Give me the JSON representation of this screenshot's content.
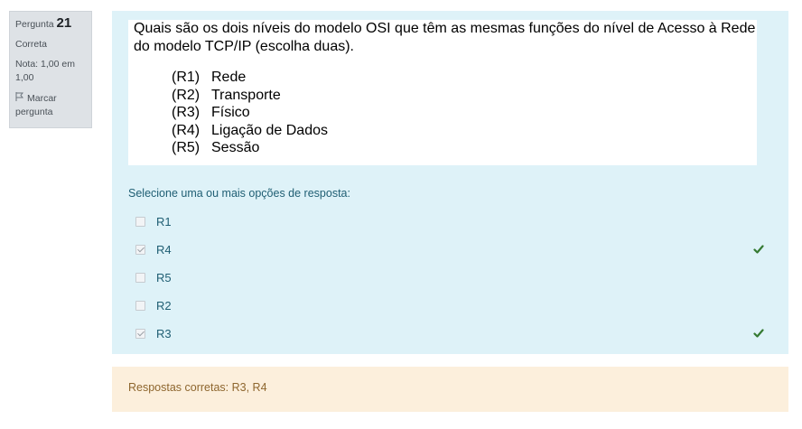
{
  "info": {
    "question_label": "Pergunta",
    "question_number": "21",
    "state": "Correta",
    "grade": "Nota: 1,00 em 1,00",
    "flag_label": "Marcar pergunta"
  },
  "question": {
    "stem": "Quais são os dois níveis do modelo OSI que têm as mesmas funções do nível de Acesso à Rede do modelo TCP/IP (escolha duas).",
    "options": [
      {
        "code": "(R1)",
        "text": "Rede"
      },
      {
        "code": "(R2)",
        "text": "Transporte"
      },
      {
        "code": "(R3)",
        "text": "Físico"
      },
      {
        "code": "(R4)",
        "text": "Ligação de Dados"
      },
      {
        "code": "(R5)",
        "text": "Sessão"
      }
    ]
  },
  "prompt": "Selecione uma ou mais opções de resposta:",
  "answers": [
    {
      "label": "R1",
      "checked": false,
      "correct": false
    },
    {
      "label": "R4",
      "checked": true,
      "correct": true
    },
    {
      "label": "R5",
      "checked": false,
      "correct": false
    },
    {
      "label": "R2",
      "checked": false,
      "correct": false
    },
    {
      "label": "R3",
      "checked": true,
      "correct": true
    }
  ],
  "feedback": "Respostas corretas: R3, R4",
  "colors": {
    "info_bg": "#dee2e6",
    "content_bg": "#def2f8",
    "feedback_bg": "#fcefdc",
    "correct_tick": "#357a32",
    "prompt_text": "#1f5e73"
  }
}
